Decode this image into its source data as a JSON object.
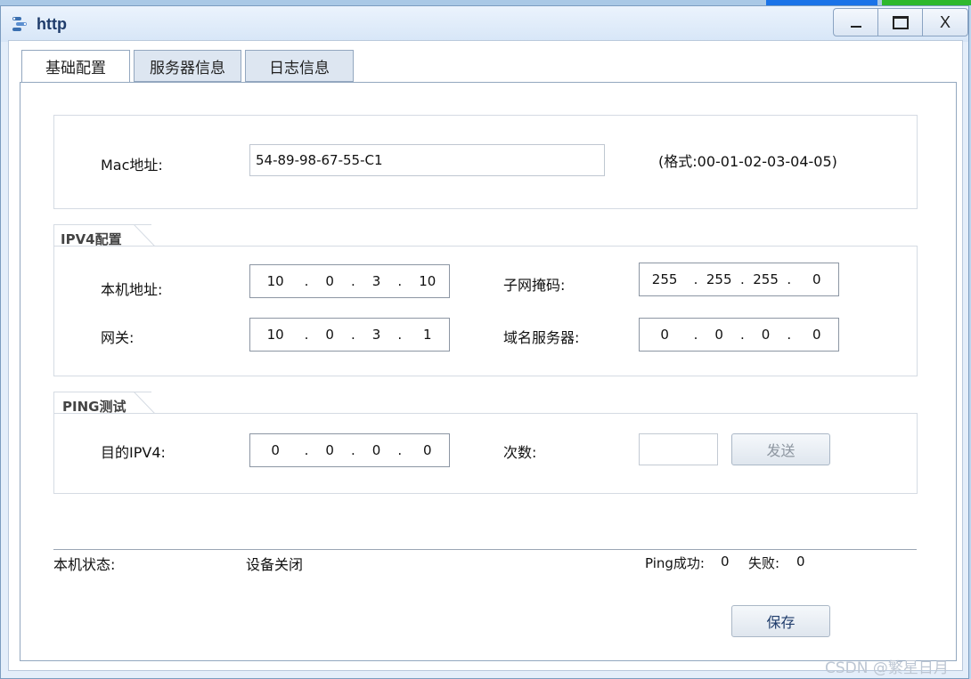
{
  "window": {
    "title": "http",
    "controls": {
      "minimize": "_",
      "maximize": "□",
      "close": "X"
    }
  },
  "tabs": [
    {
      "label": "基础配置",
      "active": true
    },
    {
      "label": "服务器信息",
      "active": false
    },
    {
      "label": "日志信息",
      "active": false
    }
  ],
  "mac": {
    "label": "Mac地址:",
    "value": "54-89-98-67-55-C1",
    "format_hint": "(格式:00-01-02-03-04-05)"
  },
  "ipv4": {
    "legend": "IPV4配置",
    "local_ip": {
      "label": "本机地址:",
      "octets": [
        "10",
        "0",
        "3",
        "10"
      ]
    },
    "subnet_mask": {
      "label": "子网掩码:",
      "octets": [
        "255",
        "255",
        "255",
        "0"
      ]
    },
    "gateway": {
      "label": "网关:",
      "octets": [
        "10",
        "0",
        "3",
        "1"
      ]
    },
    "dns": {
      "label": "域名服务器:",
      "octets": [
        "0",
        "0",
        "0",
        "0"
      ]
    }
  },
  "ping": {
    "legend": "PING测试",
    "target": {
      "label": "目的IPV4:",
      "octets": [
        "0",
        "0",
        "0",
        "0"
      ]
    },
    "count": {
      "label": "次数:",
      "value": ""
    },
    "send_button": "发送"
  },
  "status": {
    "label": "本机状态:",
    "value": "设备关闭",
    "ping_success_label": "Ping成功:",
    "ping_success_value": "0",
    "ping_fail_label": "失败:",
    "ping_fail_value": "0"
  },
  "save_button": "保存",
  "watermark": "CSDN @繁星日月",
  "colors": {
    "accent": "#1a73e8",
    "window_bg": "#e4eefa",
    "title_text": "#1f3c6b"
  }
}
